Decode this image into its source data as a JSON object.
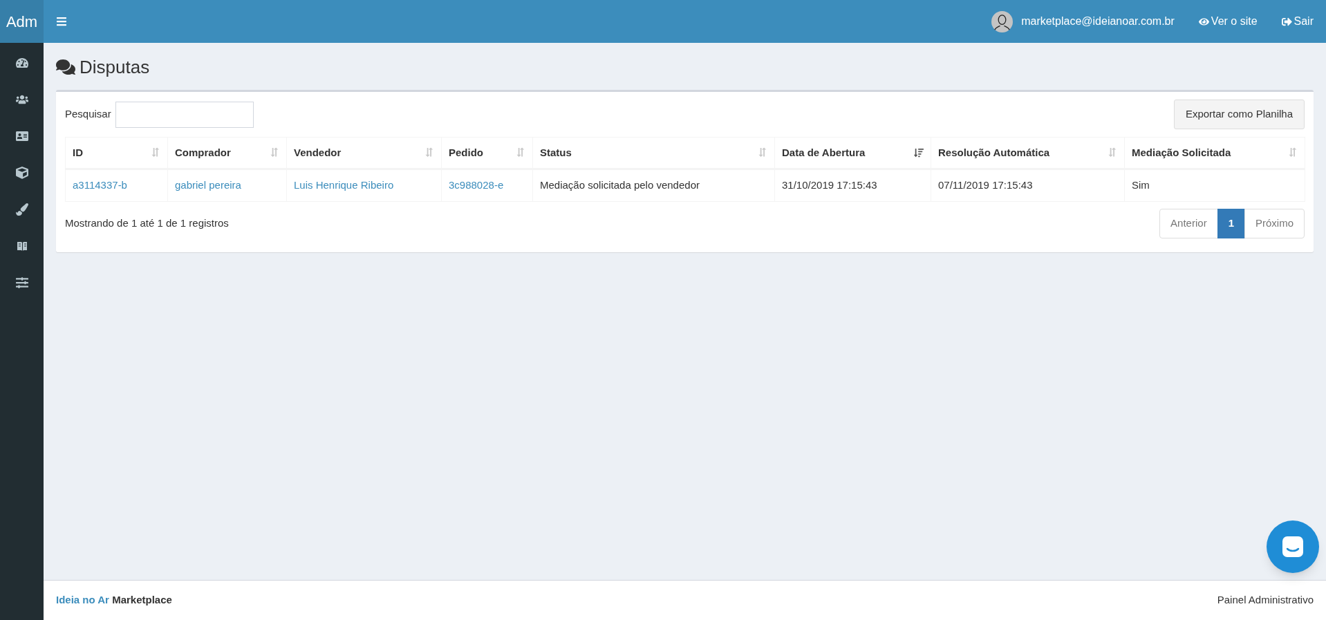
{
  "brand": "Adm",
  "topbar": {
    "user_email": "marketplace@ideianoar.com.br",
    "links": [
      {
        "kind": "view",
        "label": "Ver o site"
      },
      {
        "kind": "logout",
        "label": "Sair"
      }
    ]
  },
  "sidebar": {
    "items": [
      {
        "kind": "dashboard"
      },
      {
        "kind": "users"
      },
      {
        "kind": "card"
      },
      {
        "kind": "box"
      },
      {
        "kind": "brush"
      },
      {
        "kind": "translate"
      },
      {
        "kind": "sliders"
      }
    ]
  },
  "page": {
    "title": "Disputas"
  },
  "search": {
    "label": "Pesquisar"
  },
  "export_button": "Exportar como Planilha",
  "table": {
    "columns": [
      {
        "label": "ID",
        "sorted": false
      },
      {
        "label": "Comprador",
        "sorted": false
      },
      {
        "label": "Vendedor",
        "sorted": false
      },
      {
        "label": "Pedido",
        "sorted": false
      },
      {
        "label": "Status",
        "sorted": false
      },
      {
        "label": "Data de Abertura",
        "sorted": true
      },
      {
        "label": "Resolução Automática",
        "sorted": false
      },
      {
        "label": "Mediação Solicitada",
        "sorted": false
      }
    ],
    "rows": [
      {
        "cells": [
          {
            "text": "a3114337-b",
            "link": true
          },
          {
            "text": "gabriel pereira",
            "link": true
          },
          {
            "text": "Luis Henrique Ribeiro",
            "link": true
          },
          {
            "text": "3c988028-e",
            "link": true
          },
          {
            "text": "Mediação solicitada pelo vendedor",
            "link": false
          },
          {
            "text": "31/10/2019 17:15:43",
            "link": false
          },
          {
            "text": "07/11/2019 17:15:43",
            "link": false
          },
          {
            "text": "Sim",
            "link": false
          }
        ]
      }
    ]
  },
  "info": "Mostrando de 1 até 1 de 1 registros",
  "pagination": [
    {
      "label": "Anterior",
      "selected": false
    },
    {
      "label": "1",
      "selected": true
    },
    {
      "label": "Próximo",
      "selected": false
    }
  ],
  "footer": {
    "brand_link": "Ideia no Ar",
    "brand_text": "Marketplace",
    "right": "Painel Administrativo"
  }
}
